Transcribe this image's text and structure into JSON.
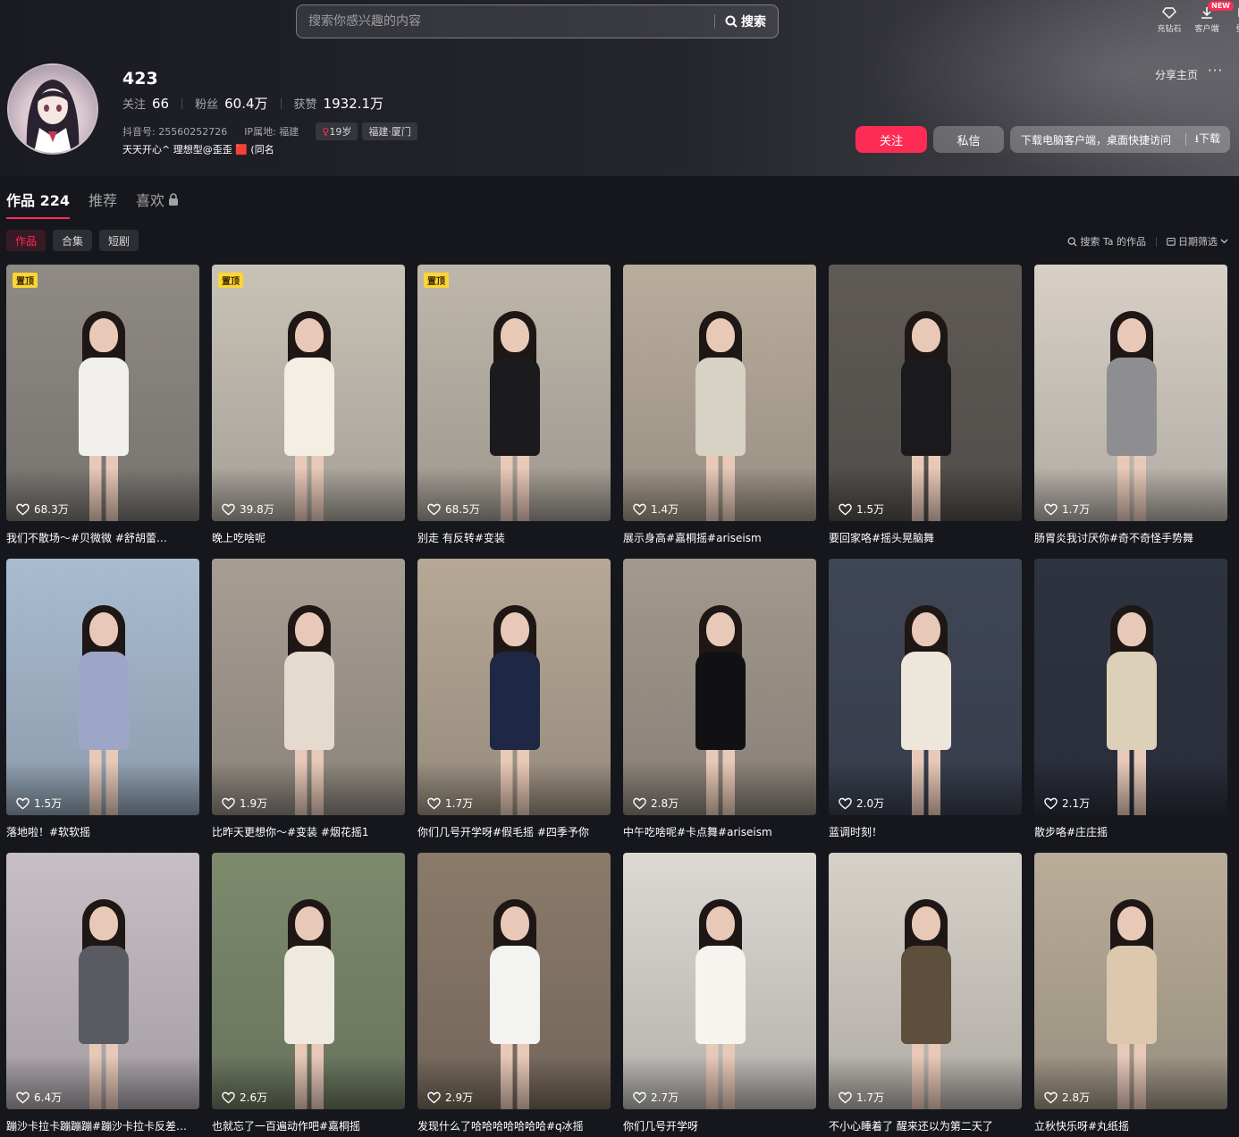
{
  "search": {
    "placeholder": "搜索你感兴趣的内容",
    "button": "搜索"
  },
  "top_icons": [
    {
      "label": "充钻石",
      "icon": "diamond-icon"
    },
    {
      "label": "客户端",
      "icon": "download-icon",
      "badge": "NEW"
    },
    {
      "label": "壁纸",
      "icon": "wallpaper-icon"
    }
  ],
  "profile": {
    "name": "423",
    "following_label": "关注",
    "following": "66",
    "followers_label": "粉丝",
    "followers": "60.4万",
    "likes_label": "获赞",
    "likes": "1932.1万",
    "douyin_id": "抖音号: 25560252726",
    "ip": "IP属地: 福建",
    "age": "19岁",
    "location": "福建·厦门",
    "bio": "天天开心^ 理想型@歪歪 🟥 (同名"
  },
  "actions": {
    "share": "分享主页",
    "more": "···",
    "follow": "关注",
    "message": "私信",
    "download_text": "下载电脑客户端，桌面快捷访问",
    "download_btn": "⭳下载"
  },
  "tabs": [
    {
      "label": "作品 224",
      "active": true
    },
    {
      "label": "推荐",
      "active": false
    },
    {
      "label": "喜欢",
      "active": false,
      "locked": true
    }
  ],
  "subtabs": [
    {
      "label": "作品",
      "active": true
    },
    {
      "label": "合集",
      "active": false
    },
    {
      "label": "短剧",
      "active": false
    }
  ],
  "tools": {
    "search_works": "搜索 Ta 的作品",
    "date_filter": "日期筛选"
  },
  "pinned_label": "置顶",
  "videos": [
    {
      "likes": "68.3万",
      "caption": "我们不散场～#贝微微 #舒胡蕾…",
      "pinned": true,
      "bg": "#8f8a84",
      "cloth": "#f2f0ec"
    },
    {
      "likes": "39.8万",
      "caption": "晚上吃啥呢",
      "pinned": true,
      "bg": "#c9c2b6",
      "cloth": "#f4efe4"
    },
    {
      "likes": "68.5万",
      "caption": "别走 有反转#变装",
      "pinned": true,
      "bg": "#bfb7ab",
      "cloth": "#1b1b1d"
    },
    {
      "likes": "1.4万",
      "caption": "展示身高#嘉桐摇#ariseism",
      "pinned": false,
      "bg": "#b9ad9c",
      "cloth": "#d8d2c4"
    },
    {
      "likes": "1.5万",
      "caption": "要回家咯#摇头晃脑舞",
      "pinned": false,
      "bg": "#5f5a55",
      "cloth": "#1a1a1c"
    },
    {
      "likes": "1.7万",
      "caption": "肠胃炎我讨厌你#奇不奇怪手势舞",
      "pinned": false,
      "bg": "#d8d0c6",
      "cloth": "#8e8e92"
    },
    {
      "likes": "1.5万",
      "caption": "落地啦！#软软摇",
      "pinned": false,
      "bg": "#a9bcd0",
      "cloth": "#9ea6c8"
    },
    {
      "likes": "1.9万",
      "caption": "比昨天更想你～#变装 #烟花摇1",
      "pinned": false,
      "bg": "#a79e93",
      "cloth": "#e4dbce"
    },
    {
      "likes": "1.7万",
      "caption": "你们几号开学呀#假毛摇 #四季予你",
      "pinned": false,
      "bg": "#b6a895",
      "cloth": "#1e2744"
    },
    {
      "likes": "2.8万",
      "caption": "中午吃啥呢#卡点舞#ariseism",
      "pinned": false,
      "bg": "#a3998d",
      "cloth": "#111113"
    },
    {
      "likes": "2.0万",
      "caption": "蓝调时刻！",
      "pinned": false,
      "bg": "#3f4656",
      "cloth": "#ece6db"
    },
    {
      "likes": "2.1万",
      "caption": "散步咯#庄庄摇",
      "pinned": false,
      "bg": "#2e3340",
      "cloth": "#ddd0b8"
    },
    {
      "likes": "6.4万",
      "caption": "蹦沙卡拉卡蹦蹦蹦#蹦沙卡拉卡反差…",
      "pinned": false,
      "bg": "#c7bfc4",
      "cloth": "#5a5a62"
    },
    {
      "likes": "2.6万",
      "caption": "也就忘了一百遍动作吧#嘉桐摇",
      "pinned": false,
      "bg": "#7d8a6c",
      "cloth": "#efeadf"
    },
    {
      "likes": "2.9万",
      "caption": "发现什么了哈哈哈哈哈哈哈#q冰摇",
      "pinned": false,
      "bg": "#8a7a6a",
      "cloth": "#f3f3f1"
    },
    {
      "likes": "2.7万",
      "caption": "你们几号开学呀",
      "pinned": false,
      "bg": "#dcd8d2",
      "cloth": "#f6f4ef"
    },
    {
      "likes": "1.7万",
      "caption": "不小心睡着了 醒来还以为第二天了",
      "pinned": false,
      "bg": "#d6d1c8",
      "cloth": "#5e4f3c"
    },
    {
      "likes": "2.8万",
      "caption": "立秋快乐呀#丸纸摇",
      "pinned": false,
      "bg": "#b9ad98",
      "cloth": "#ddc8ae"
    }
  ]
}
